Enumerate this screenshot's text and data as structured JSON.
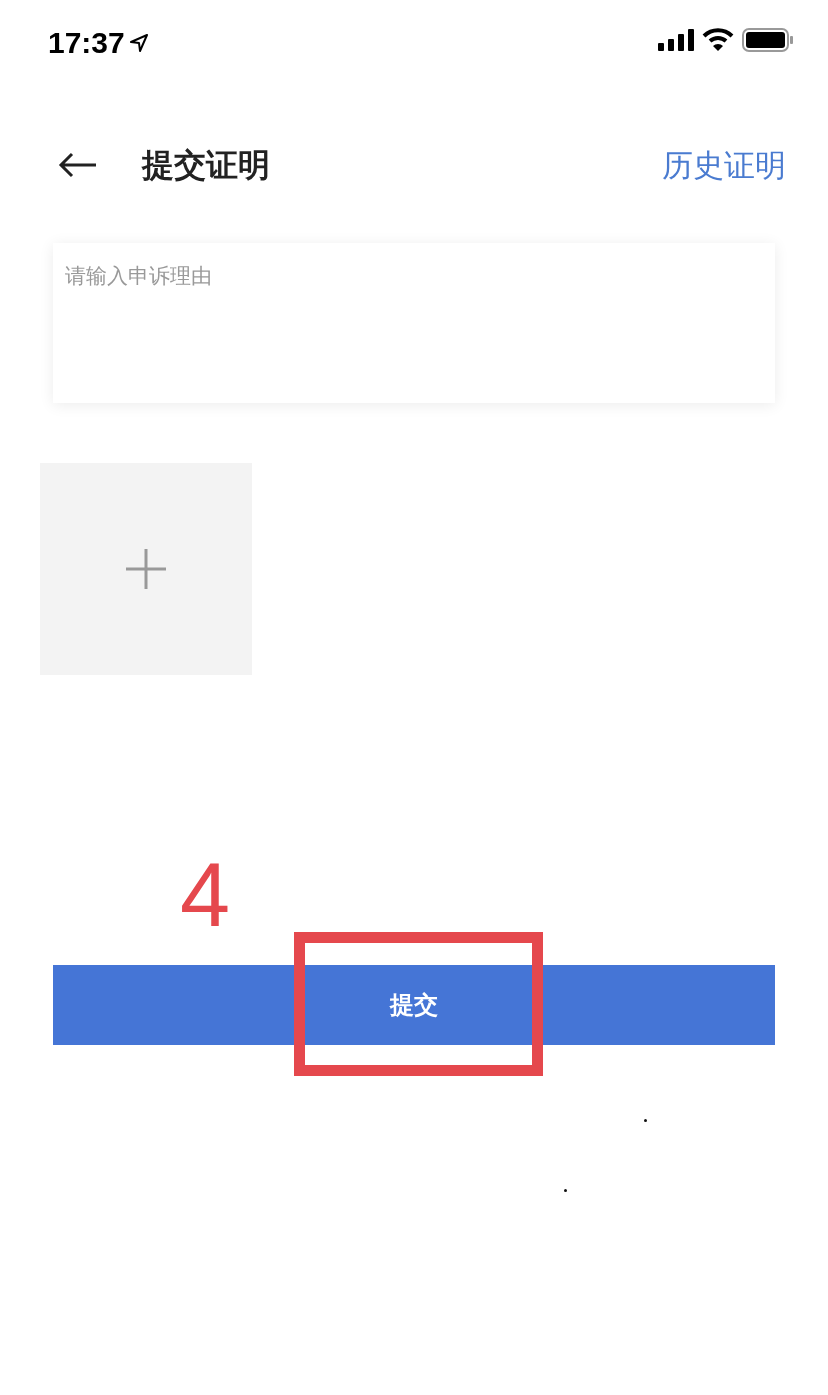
{
  "status_bar": {
    "time": "17:37"
  },
  "header": {
    "title": "提交证明",
    "action": "历史证明"
  },
  "reason_field": {
    "placeholder": "请输入申诉理由"
  },
  "upload": {
    "kind": "add"
  },
  "submit_button": {
    "label": "提交"
  },
  "annotation": {
    "number": "4"
  }
}
